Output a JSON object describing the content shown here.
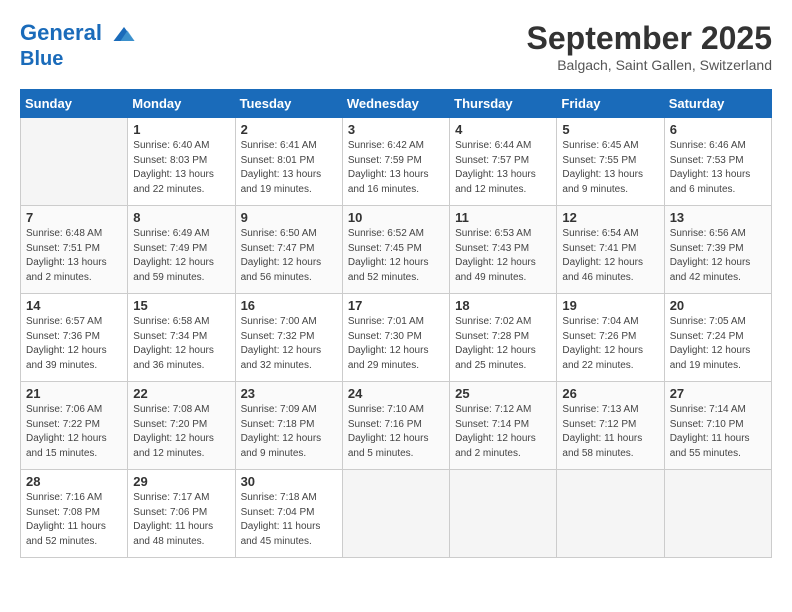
{
  "header": {
    "logo_line1": "General",
    "logo_line2": "Blue",
    "month": "September 2025",
    "location": "Balgach, Saint Gallen, Switzerland"
  },
  "weekdays": [
    "Sunday",
    "Monday",
    "Tuesday",
    "Wednesday",
    "Thursday",
    "Friday",
    "Saturday"
  ],
  "weeks": [
    [
      {
        "day": "",
        "info": ""
      },
      {
        "day": "1",
        "info": "Sunrise: 6:40 AM\nSunset: 8:03 PM\nDaylight: 13 hours\nand 22 minutes."
      },
      {
        "day": "2",
        "info": "Sunrise: 6:41 AM\nSunset: 8:01 PM\nDaylight: 13 hours\nand 19 minutes."
      },
      {
        "day": "3",
        "info": "Sunrise: 6:42 AM\nSunset: 7:59 PM\nDaylight: 13 hours\nand 16 minutes."
      },
      {
        "day": "4",
        "info": "Sunrise: 6:44 AM\nSunset: 7:57 PM\nDaylight: 13 hours\nand 12 minutes."
      },
      {
        "day": "5",
        "info": "Sunrise: 6:45 AM\nSunset: 7:55 PM\nDaylight: 13 hours\nand 9 minutes."
      },
      {
        "day": "6",
        "info": "Sunrise: 6:46 AM\nSunset: 7:53 PM\nDaylight: 13 hours\nand 6 minutes."
      }
    ],
    [
      {
        "day": "7",
        "info": "Sunrise: 6:48 AM\nSunset: 7:51 PM\nDaylight: 13 hours\nand 2 minutes."
      },
      {
        "day": "8",
        "info": "Sunrise: 6:49 AM\nSunset: 7:49 PM\nDaylight: 12 hours\nand 59 minutes."
      },
      {
        "day": "9",
        "info": "Sunrise: 6:50 AM\nSunset: 7:47 PM\nDaylight: 12 hours\nand 56 minutes."
      },
      {
        "day": "10",
        "info": "Sunrise: 6:52 AM\nSunset: 7:45 PM\nDaylight: 12 hours\nand 52 minutes."
      },
      {
        "day": "11",
        "info": "Sunrise: 6:53 AM\nSunset: 7:43 PM\nDaylight: 12 hours\nand 49 minutes."
      },
      {
        "day": "12",
        "info": "Sunrise: 6:54 AM\nSunset: 7:41 PM\nDaylight: 12 hours\nand 46 minutes."
      },
      {
        "day": "13",
        "info": "Sunrise: 6:56 AM\nSunset: 7:39 PM\nDaylight: 12 hours\nand 42 minutes."
      }
    ],
    [
      {
        "day": "14",
        "info": "Sunrise: 6:57 AM\nSunset: 7:36 PM\nDaylight: 12 hours\nand 39 minutes."
      },
      {
        "day": "15",
        "info": "Sunrise: 6:58 AM\nSunset: 7:34 PM\nDaylight: 12 hours\nand 36 minutes."
      },
      {
        "day": "16",
        "info": "Sunrise: 7:00 AM\nSunset: 7:32 PM\nDaylight: 12 hours\nand 32 minutes."
      },
      {
        "day": "17",
        "info": "Sunrise: 7:01 AM\nSunset: 7:30 PM\nDaylight: 12 hours\nand 29 minutes."
      },
      {
        "day": "18",
        "info": "Sunrise: 7:02 AM\nSunset: 7:28 PM\nDaylight: 12 hours\nand 25 minutes."
      },
      {
        "day": "19",
        "info": "Sunrise: 7:04 AM\nSunset: 7:26 PM\nDaylight: 12 hours\nand 22 minutes."
      },
      {
        "day": "20",
        "info": "Sunrise: 7:05 AM\nSunset: 7:24 PM\nDaylight: 12 hours\nand 19 minutes."
      }
    ],
    [
      {
        "day": "21",
        "info": "Sunrise: 7:06 AM\nSunset: 7:22 PM\nDaylight: 12 hours\nand 15 minutes."
      },
      {
        "day": "22",
        "info": "Sunrise: 7:08 AM\nSunset: 7:20 PM\nDaylight: 12 hours\nand 12 minutes."
      },
      {
        "day": "23",
        "info": "Sunrise: 7:09 AM\nSunset: 7:18 PM\nDaylight: 12 hours\nand 9 minutes."
      },
      {
        "day": "24",
        "info": "Sunrise: 7:10 AM\nSunset: 7:16 PM\nDaylight: 12 hours\nand 5 minutes."
      },
      {
        "day": "25",
        "info": "Sunrise: 7:12 AM\nSunset: 7:14 PM\nDaylight: 12 hours\nand 2 minutes."
      },
      {
        "day": "26",
        "info": "Sunrise: 7:13 AM\nSunset: 7:12 PM\nDaylight: 11 hours\nand 58 minutes."
      },
      {
        "day": "27",
        "info": "Sunrise: 7:14 AM\nSunset: 7:10 PM\nDaylight: 11 hours\nand 55 minutes."
      }
    ],
    [
      {
        "day": "28",
        "info": "Sunrise: 7:16 AM\nSunset: 7:08 PM\nDaylight: 11 hours\nand 52 minutes."
      },
      {
        "day": "29",
        "info": "Sunrise: 7:17 AM\nSunset: 7:06 PM\nDaylight: 11 hours\nand 48 minutes."
      },
      {
        "day": "30",
        "info": "Sunrise: 7:18 AM\nSunset: 7:04 PM\nDaylight: 11 hours\nand 45 minutes."
      },
      {
        "day": "",
        "info": ""
      },
      {
        "day": "",
        "info": ""
      },
      {
        "day": "",
        "info": ""
      },
      {
        "day": "",
        "info": ""
      }
    ]
  ]
}
